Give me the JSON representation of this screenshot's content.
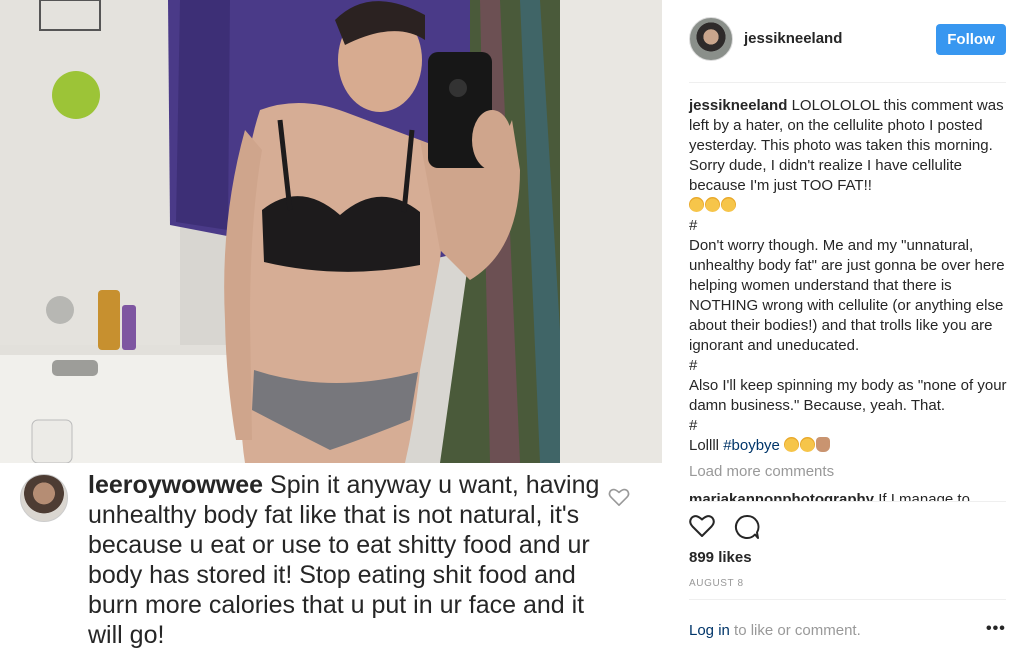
{
  "colors": {
    "follow_button": "#3897f0",
    "link": "#003569",
    "muted": "#999999",
    "divider": "#efefef"
  },
  "comment_screenshot": {
    "username": "leeroywowwee",
    "text": "Spin it anyway u want, having unhealthy body fat like that is not natural, it's because u eat or use to eat shitty food and ur body has stored it! Stop eating shit food and burn more calories that u put in ur face and it will go!",
    "heart_icon": "heart-outline-icon"
  },
  "header": {
    "username": "jessikneeland",
    "follow_label": "Follow"
  },
  "caption": {
    "username": "jessikneeland",
    "paragraph1": "LOLOLOLOL this comment was left by a hater, on the cellulite photo I posted yesterday. This photo was taken this morning. Sorry dude, I didn't realize I have cellulite because I'm just TOO FAT!!",
    "hash1": "#",
    "paragraph2": "Don't worry though. Me and my \"unnatural, unhealthy body fat\" are just gonna be over here helping women understand that there is NOTHING wrong with cellulite (or anything else about their bodies!) and that trolls like you are ignorant and uneducated.",
    "hash2": "#",
    "paragraph3": "Also I'll keep spinning my body as \"none of your damn business.\" Because, yeah. That.",
    "hash3": "#",
    "last_line_text": "Lollll ",
    "last_line_tag": "#boybye"
  },
  "load_more_label": "Load more comments",
  "next_comment": {
    "username": "mariakannonphotography",
    "text": "If I manage to"
  },
  "actions": {
    "like_icon": "heart-outline-icon",
    "comment_icon": "comment-bubble-icon"
  },
  "likes": "899 likes",
  "date": "AUGUST 8",
  "footer": {
    "login_link": "Log in",
    "login_rest": " to like or comment.",
    "more_label": "•••"
  }
}
